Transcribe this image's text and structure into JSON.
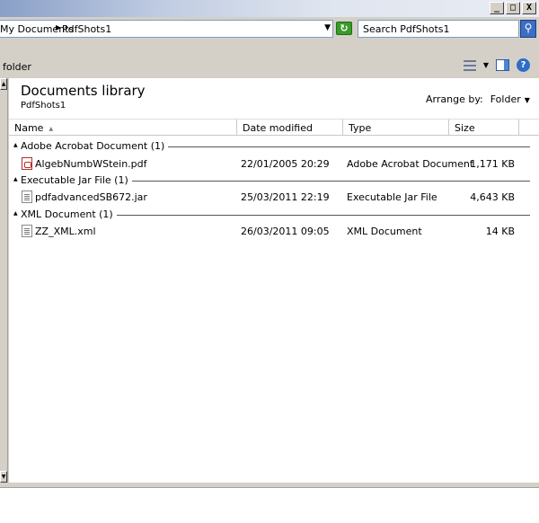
{
  "window": {
    "controls": [
      "_",
      "□",
      "X"
    ]
  },
  "address": {
    "crumbs": [
      "My Documents",
      "PdfShots1"
    ],
    "search_placeholder": "Search PdfShots1"
  },
  "toolbar": {
    "folder_label": "folder",
    "icons": [
      "views-icon",
      "chevron-down-icon",
      "preview-pane-icon",
      "help-icon"
    ]
  },
  "library": {
    "title": "Documents library",
    "subtitle": "PdfShots1",
    "arrange_label": "Arrange by:",
    "arrange_value": "Folder"
  },
  "columns": [
    "Name",
    "Date modified",
    "Type",
    "Size"
  ],
  "groups": [
    {
      "label": "Adobe Acrobat Document (1)",
      "files": [
        {
          "name": "AlgebNumbWStein.pdf",
          "date": "22/01/2005 20:29",
          "type": "Adobe Acrobat Document",
          "size": "1,171 KB",
          "icon": "pdf-icon"
        }
      ]
    },
    {
      "label": "Executable Jar File (1)",
      "files": [
        {
          "name": "pdfadvancedSB672.jar",
          "date": "25/03/2011 22:19",
          "type": "Executable Jar File",
          "size": "4,643 KB",
          "icon": "jar-file-icon"
        }
      ]
    },
    {
      "label": "XML Document (1)",
      "files": [
        {
          "name": "ZZ_XML.xml",
          "date": "26/03/2011 09:05",
          "type": "XML Document",
          "size": "14 KB",
          "icon": "xml-file-icon"
        }
      ]
    }
  ]
}
